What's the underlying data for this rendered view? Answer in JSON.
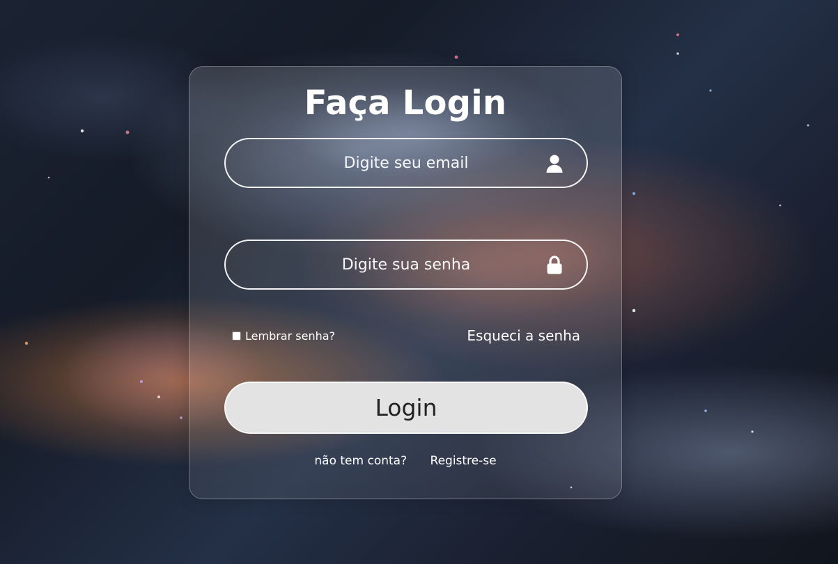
{
  "colors": {
    "background_deep": "#151b27",
    "background_mid": "#243047",
    "nebula_orange": "#e0823e",
    "nebula_blue": "#b9d2ff",
    "card_border": "#ffffff",
    "button_background": "#e3e3e3",
    "button_text": "#222222",
    "text_primary": "#ffffff"
  },
  "background": {
    "icon": "galaxy-background"
  },
  "login": {
    "title": "Faça Login",
    "email": {
      "placeholder": "Digite seu email",
      "value": "",
      "icon": "user-icon"
    },
    "password": {
      "placeholder": "Digite sua senha",
      "value": "",
      "icon": "lock-icon"
    },
    "remember": {
      "label": "Lembrar senha?",
      "checked": false
    },
    "forgot_password": "Esqueci a senha",
    "submit_label": "Login",
    "register": {
      "prompt": "não tem conta?",
      "link": "Registre-se"
    }
  }
}
